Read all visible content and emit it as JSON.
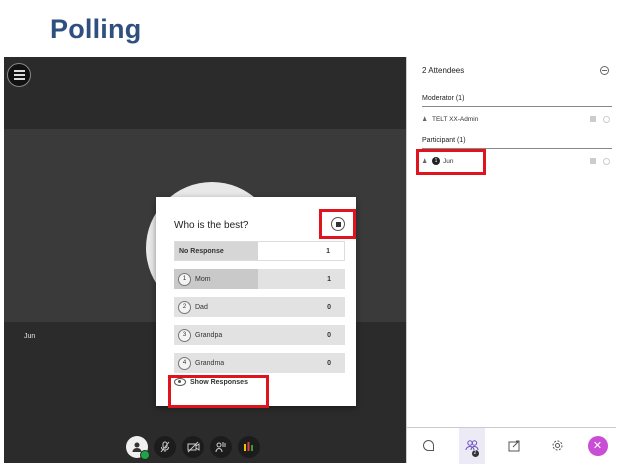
{
  "slide": {
    "title": "Polling"
  },
  "stage": {
    "video_name": "Jun",
    "controls": [
      {
        "name": "my-status",
        "icon": "user-icon"
      },
      {
        "name": "microphone-toggle",
        "icon": "mic-off-icon"
      },
      {
        "name": "camera-toggle",
        "icon": "camera-off-icon"
      },
      {
        "name": "raise-hand",
        "icon": "hand-icon"
      },
      {
        "name": "share-content",
        "icon": "share-icon"
      }
    ]
  },
  "poll": {
    "question": "Who is the best?",
    "no_response": {
      "label": "No Response",
      "count": "1",
      "fraction": 0.49
    },
    "options": [
      {
        "num": "1",
        "label": "Mom",
        "count": "1",
        "fraction": 0.49
      },
      {
        "num": "2",
        "label": "Dad",
        "count": "0",
        "fraction": 0.0
      },
      {
        "num": "3",
        "label": "Grandpa",
        "count": "0",
        "fraction": 0.0
      },
      {
        "num": "4",
        "label": "Grandma",
        "count": "0",
        "fraction": 0.0
      }
    ],
    "show_responses_label": "Show Responses"
  },
  "attendees": {
    "title": "2 Attendees",
    "moderator_group": "Moderator (1)",
    "moderator": "TELT XX-Admin",
    "participant_group": "Participant (1)",
    "participant": "Jun",
    "participant_badge": "1"
  },
  "tabs": {
    "attendee_count": "2"
  },
  "colors": {
    "highlight": "#e0141e",
    "title": "#2f4f7f",
    "accent": "#6a4fc4"
  }
}
